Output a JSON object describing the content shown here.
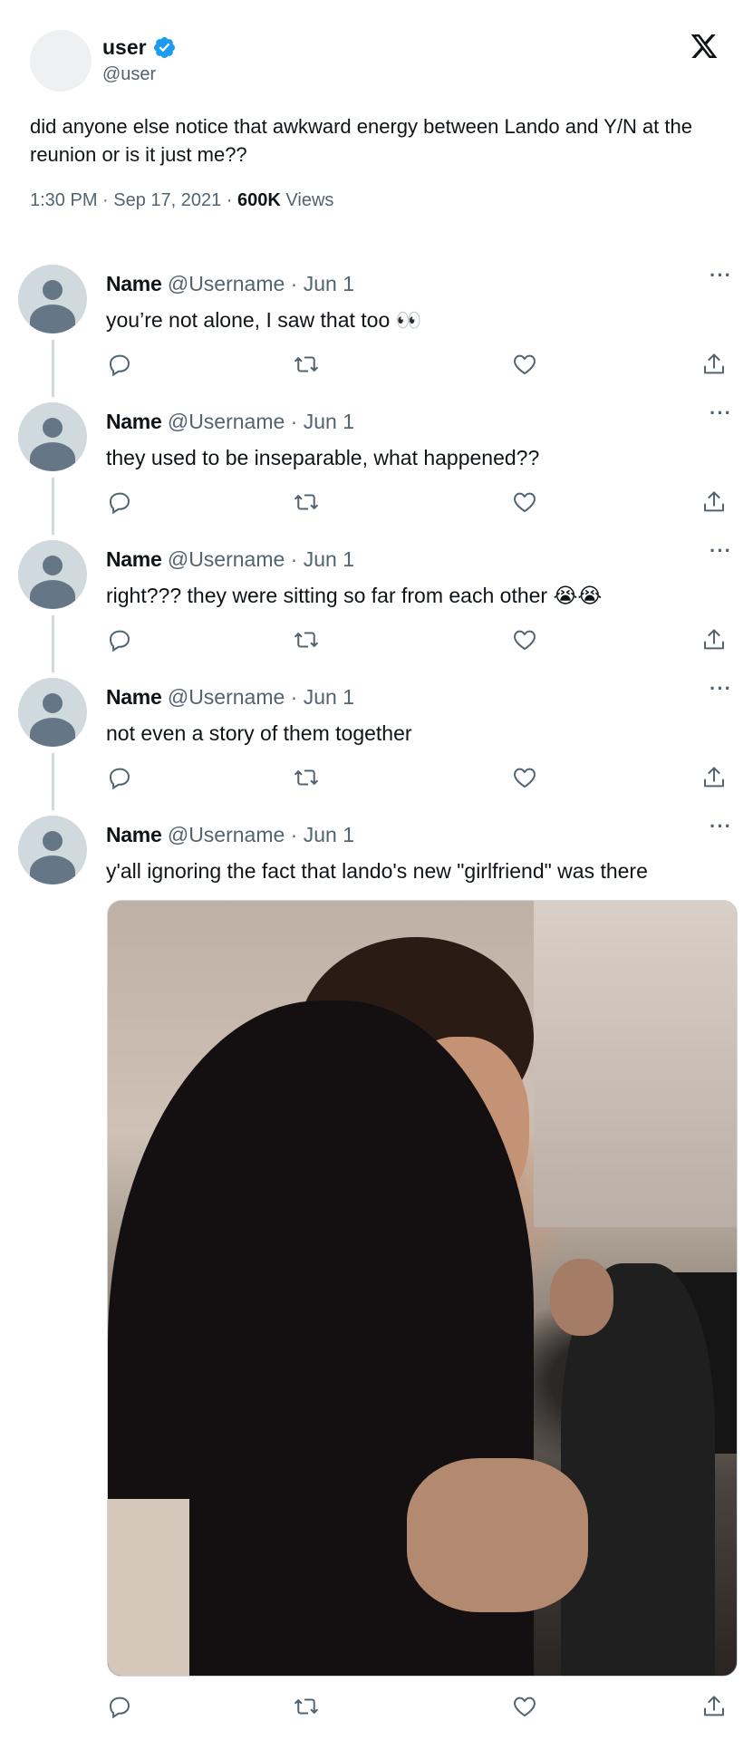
{
  "tweet": {
    "display_name": "user",
    "handle": "@user",
    "text": "did anyone else notice that awkward energy between Lando and Y/N at the reunion or is it just me??",
    "timestamp": "1:30 PM · Sep 17, 2021 · ",
    "views_count": "600K",
    "views_label": " Views"
  },
  "replies": [
    {
      "name": "Name",
      "handle": "@Username",
      "dot": " · ",
      "date": "Jun 1",
      "text": "you’re not alone, I saw that too 👀"
    },
    {
      "name": "Name",
      "handle": "@Username",
      "dot": " · ",
      "date": "Jun 1",
      "text": "they used to be inseparable, what happened??"
    },
    {
      "name": "Name",
      "handle": "@Username",
      "dot": " · ",
      "date": "Jun 1",
      "text": "right??? they were sitting so far from each other 😭😭"
    },
    {
      "name": "Name",
      "handle": "@Username",
      "dot": " · ",
      "date": "Jun 1",
      "text": "not even a story of them together"
    },
    {
      "name": "Name",
      "handle": "@Username",
      "dot": " · ",
      "date": "Jun 1",
      "text": "y'all ignoring the fact that lando's new \"girlfriend\" was there"
    }
  ],
  "more_label": "···",
  "icons": {
    "reply": "reply-icon",
    "retweet": "retweet-icon",
    "like": "heart-icon",
    "share": "share-icon",
    "logo": "x-logo-icon",
    "verified": "verified-badge-icon"
  },
  "colors": {
    "verified": "#1d9bf0",
    "secondary_text": "#536471",
    "icon": "#536471"
  }
}
